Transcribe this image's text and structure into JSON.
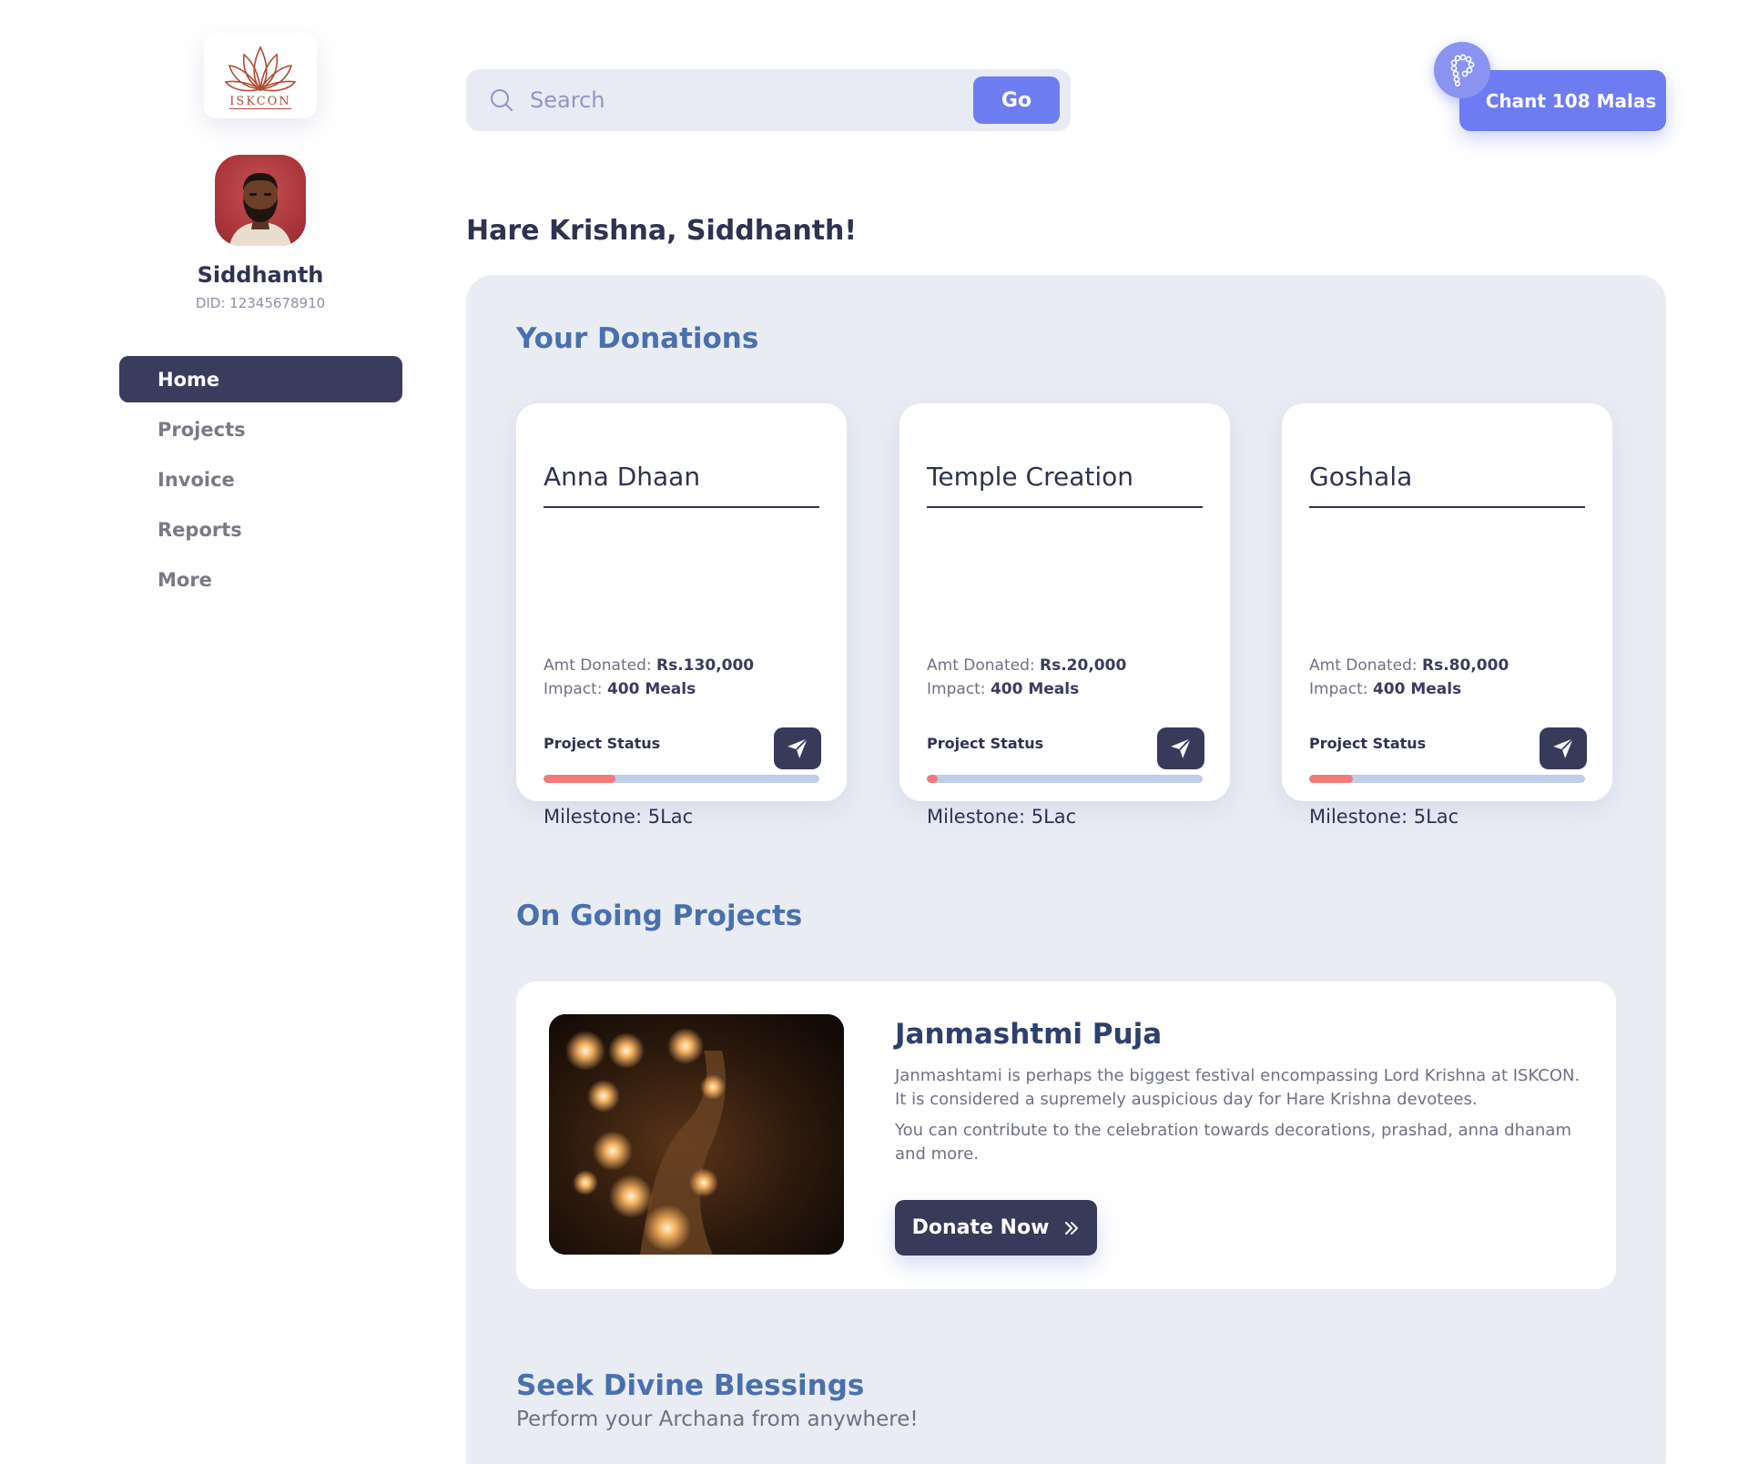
{
  "brand": {
    "logo_text": "ISKCON"
  },
  "user": {
    "name": "Siddhanth",
    "did": "DID: 12345678910"
  },
  "nav": {
    "items": [
      {
        "label": "Home",
        "active": true
      },
      {
        "label": "Projects",
        "active": false
      },
      {
        "label": "Invoice",
        "active": false
      },
      {
        "label": "Reports",
        "active": false
      },
      {
        "label": "More",
        "active": false
      }
    ]
  },
  "search": {
    "placeholder": "Search",
    "value": "",
    "go_label": "Go"
  },
  "chant": {
    "label": "Chant 108 Malas",
    "icon": "mala-beads-icon"
  },
  "greeting": "Hare Krishna, Siddhanth!",
  "donations": {
    "title": "Your Donations",
    "amount_label": "Amt Donated:",
    "impact_label": "Impact:",
    "status_label": "Project Status",
    "cards": [
      {
        "title": "Anna Dhaan",
        "amount": "Rs.130,000",
        "impact": "400 Meals",
        "progress_percent": 26,
        "milestone": "Milestone: 5Lac"
      },
      {
        "title": "Temple Creation",
        "amount": "Rs.20,000",
        "impact": "400 Meals",
        "progress_percent": 4,
        "milestone": "Milestone: 5Lac"
      },
      {
        "title": "Goshala",
        "amount": "Rs.80,000",
        "impact": "400 Meals",
        "progress_percent": 16,
        "milestone": "Milestone: 5Lac"
      }
    ]
  },
  "ongoing": {
    "title": "On Going Projects",
    "project": {
      "title": "Janmashtmi Puja",
      "desc1": "Janmashtami is perhaps the biggest festival encompassing Lord Krishna at ISKCON. It is considered a supremely auspicious day for Hare Krishna devotees.",
      "desc2": "You can contribute to the celebration towards decorations, prashad, anna dhanam and more.",
      "donate_label": "Donate Now"
    }
  },
  "blessings": {
    "title": "Seek Divine Blessings",
    "subtitle": "Perform your Archana from anywhere!"
  },
  "colors": {
    "accent": "#6e7cf2",
    "navy": "#383a5a",
    "section_title": "#4a70ac",
    "progress_fill": "#ef7b7b",
    "progress_track": "#bfcde9",
    "panel_bg": "#e9ecf3"
  }
}
